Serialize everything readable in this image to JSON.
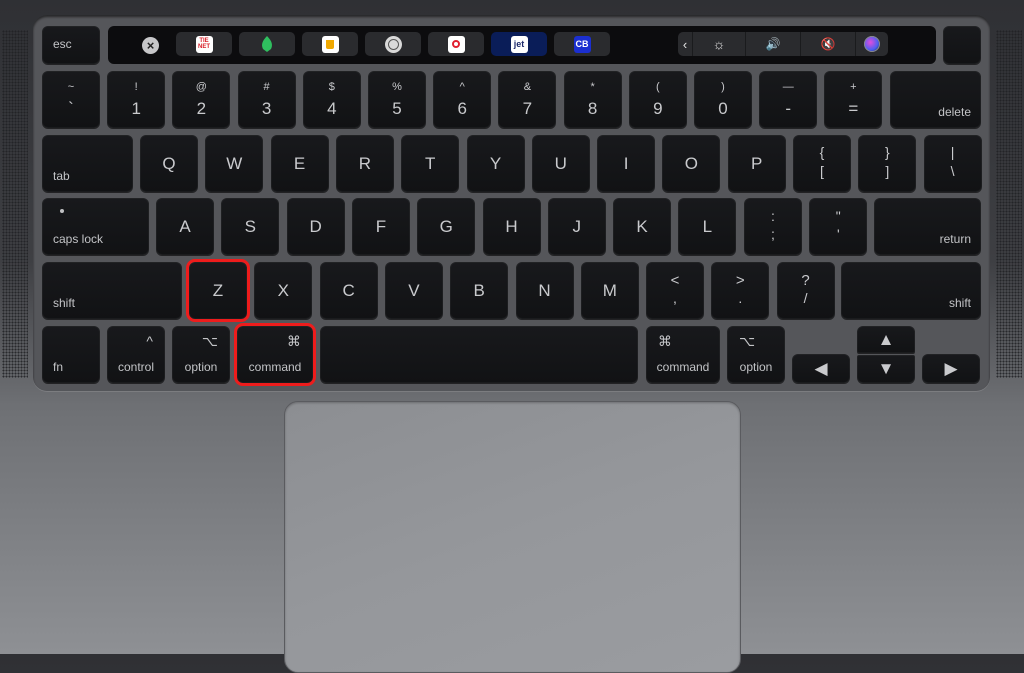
{
  "touchbar": {
    "close_icon": "close-circle-icon",
    "apps": [
      {
        "name": "app-the-net-icon",
        "text": "TIE NET",
        "bg": "#ffffff",
        "fg": "#d8202a",
        "selected": false
      },
      {
        "name": "app-evernote-leaf-icon",
        "text": "",
        "bg": "transparent",
        "fg": "#2fbf5f",
        "selected": false
      },
      {
        "name": "app-cup-icon",
        "text": "",
        "bg": "#ffffff",
        "fg": "#f0a800",
        "selected": false
      },
      {
        "name": "app-gear-badge-icon",
        "text": "",
        "bg": "#d9d9d9",
        "fg": "#555555",
        "selected": false
      },
      {
        "name": "app-record-icon",
        "text": "",
        "bg": "#ffffff",
        "fg": "#e02030",
        "selected": false
      },
      {
        "name": "app-jet-icon",
        "text": "jet",
        "bg": "#ffffff",
        "fg": "#1d2a6b",
        "selected": true
      },
      {
        "name": "app-cb-icon",
        "text": "CB",
        "bg": "#1b2fd0",
        "fg": "#ffffff",
        "selected": false
      }
    ],
    "control_strip": {
      "expand": "‹",
      "brightness": "☼",
      "volume": "🔊",
      "mute": "🔇",
      "siri": "siri-icon"
    }
  },
  "rows": {
    "fn_row": {
      "esc": "esc"
    },
    "number_row": [
      {
        "top": "~",
        "bottom": "`"
      },
      {
        "top": "!",
        "bottom": "1"
      },
      {
        "top": "@",
        "bottom": "2"
      },
      {
        "top": "#",
        "bottom": "3"
      },
      {
        "top": "$",
        "bottom": "4"
      },
      {
        "top": "%",
        "bottom": "5"
      },
      {
        "top": "^",
        "bottom": "6"
      },
      {
        "top": "&",
        "bottom": "7"
      },
      {
        "top": "*",
        "bottom": "8"
      },
      {
        "top": "(",
        "bottom": "9"
      },
      {
        "top": ")",
        "bottom": "0"
      },
      {
        "top": "—",
        "bottom": "-"
      },
      {
        "top": "+",
        "bottom": "="
      }
    ],
    "delete": "delete",
    "tab": "tab",
    "qwerty": [
      "Q",
      "W",
      "E",
      "R",
      "T",
      "Y",
      "U",
      "I",
      "O",
      "P"
    ],
    "brackets": [
      {
        "top": "{",
        "bottom": "["
      },
      {
        "top": "}",
        "bottom": "]"
      },
      {
        "top": "|",
        "bottom": "\\"
      }
    ],
    "caps_lock": "caps lock",
    "home": [
      "A",
      "S",
      "D",
      "F",
      "G",
      "H",
      "J",
      "K",
      "L"
    ],
    "home_punct": [
      {
        "top": ":",
        "bottom": ";"
      },
      {
        "top": "\"",
        "bottom": "'"
      }
    ],
    "return": "return",
    "shift": "shift",
    "bottom_letters": [
      "Z",
      "X",
      "C",
      "V",
      "B",
      "N",
      "M"
    ],
    "bottom_punct": [
      {
        "top": "<",
        "bottom": ","
      },
      {
        "top": ">",
        "bottom": "."
      },
      {
        "top": "?",
        "bottom": "/"
      }
    ],
    "modifiers": {
      "fn": "fn",
      "control": "control",
      "control_symbol": "^",
      "option": "option",
      "option_symbol": "⌥",
      "command": "command",
      "command_symbol": "⌘"
    },
    "arrows": {
      "left": "◀",
      "up": "▲",
      "down": "▼",
      "right": "▶"
    }
  },
  "highlights": {
    "color": "#ee1c1c",
    "keys": [
      "Z",
      "left command"
    ]
  }
}
